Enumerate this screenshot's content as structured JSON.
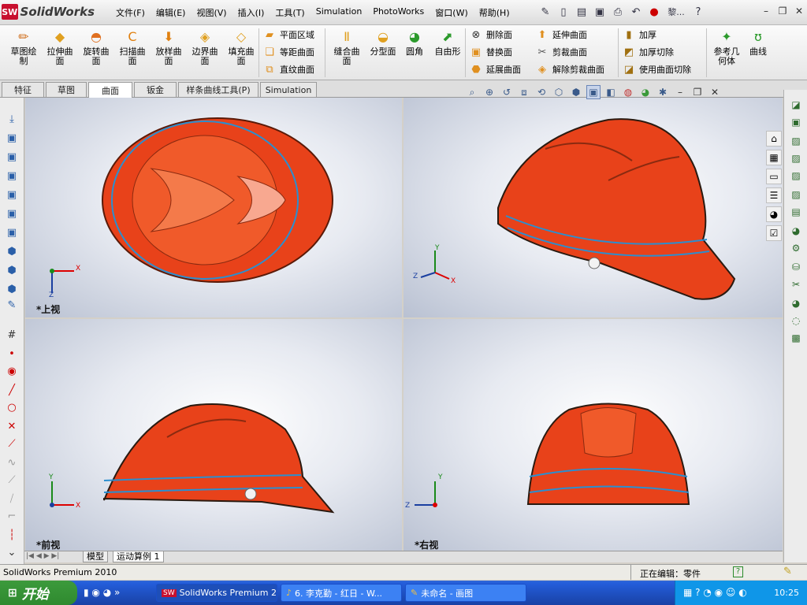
{
  "app": {
    "logo_mark": "SW",
    "logo_text": "SolidWorks"
  },
  "menu": [
    "文件(F)",
    "编辑(E)",
    "视图(V)",
    "插入(I)",
    "工具(T)",
    "Simulation",
    "PhotoWorks",
    "窗口(W)",
    "帮助(H)"
  ],
  "quick_access_extra": "黎...",
  "ribbon": {
    "big_buttons": [
      {
        "label": "草图绘\n制",
        "icon": "sketch-icon"
      },
      {
        "label": "拉伸曲\n面",
        "icon": "extrude-surface-icon"
      },
      {
        "label": "旋转曲\n面",
        "icon": "revolve-surface-icon"
      },
      {
        "label": "扫描曲\n面",
        "icon": "sweep-surface-icon"
      },
      {
        "label": "放样曲\n面",
        "icon": "loft-surface-icon"
      },
      {
        "label": "边界曲\n面",
        "icon": "boundary-surface-icon"
      },
      {
        "label": "填充曲\n面",
        "icon": "fill-surface-icon"
      }
    ],
    "col1": [
      "平面区域",
      "等距曲面",
      "直纹曲面"
    ],
    "mid_buttons": [
      "缝合曲\n面",
      "分型面",
      "圆角",
      "自由形"
    ],
    "col2": [
      "删除面",
      "替换面",
      "延展曲面"
    ],
    "col3": [
      "延伸曲面",
      "剪裁曲面",
      "解除剪裁曲面"
    ],
    "col4": [
      "加厚",
      "加厚切除",
      "使用曲面切除"
    ],
    "right_buttons": [
      "参考几\n何体",
      "曲线"
    ]
  },
  "tabs": [
    "特征",
    "草图",
    "曲面",
    "钣金",
    "样条曲线工具(P)",
    "Simulation"
  ],
  "active_tab": "曲面",
  "viewports": {
    "top": "*上视",
    "iso": "",
    "front": "*前视",
    "right": "*右视"
  },
  "axes": {
    "x": "X",
    "y": "Y",
    "z": "Z"
  },
  "bottom_tabs": [
    "模型",
    "运动算例 1"
  ],
  "status": {
    "left": "SolidWorks Premium 2010",
    "right": "正在编辑：零件",
    "help": "?"
  },
  "taskbar": {
    "start": "开始",
    "tasks": [
      "SolidWorks Premium 2...",
      "6. 李克勤 - 红日 - W...",
      "未命名 - 画图"
    ],
    "time": "10:25"
  },
  "colors": {
    "helmet": "#e8421a",
    "edge": "#2a8fd0",
    "viewport_bg": "#c8cfdd",
    "taskbar": "#245edb",
    "start": "#3c9a3c"
  }
}
